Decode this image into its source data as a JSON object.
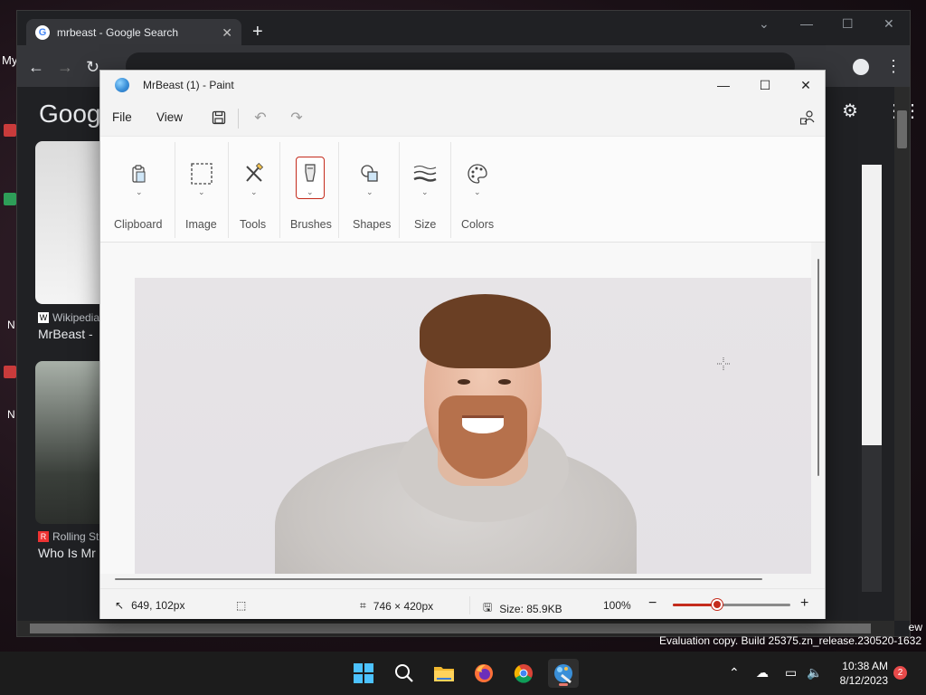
{
  "desktop": {
    "side_texts": [
      "My",
      "N",
      "N"
    ]
  },
  "chrome": {
    "tab_title": "mrbeast - Google Search",
    "tab_close": "✕",
    "new_tab": "+",
    "google_logo": "Goog",
    "results": [
      {
        "source": "Wikipedia",
        "title": "MrBeast - "
      },
      {
        "source": "Rolling St",
        "title": "Who Is Mr"
      }
    ]
  },
  "paint": {
    "title": "MrBeast (1) - Paint",
    "menu": {
      "file": "File",
      "view": "View"
    },
    "ribbon": [
      {
        "label": "Clipboard",
        "icon": "clipboard-icon"
      },
      {
        "label": "Image",
        "icon": "selection-icon"
      },
      {
        "label": "Tools",
        "icon": "tools-icon"
      },
      {
        "label": "Brushes",
        "icon": "brush-icon"
      },
      {
        "label": "Shapes",
        "icon": "shapes-icon"
      },
      {
        "label": "Size",
        "icon": "size-icon"
      },
      {
        "label": "Colors",
        "icon": "palette-icon"
      }
    ],
    "status": {
      "cursor_pos": "649, 102px",
      "canvas_size": "746 × 420px",
      "file_size": "Size: 85.9KB",
      "zoom": "100%",
      "zoom_fraction": 0.38
    }
  },
  "taskbar": {
    "time": "10:38 AM",
    "date": "8/12/2023",
    "notification_count": "2"
  },
  "watermark": "Evaluation copy. Build 25375.zn_release.230520-1632",
  "watermark_fragment": "ew",
  "colors": {
    "accent": "#c42b1c",
    "chrome_bg": "#202124"
  }
}
